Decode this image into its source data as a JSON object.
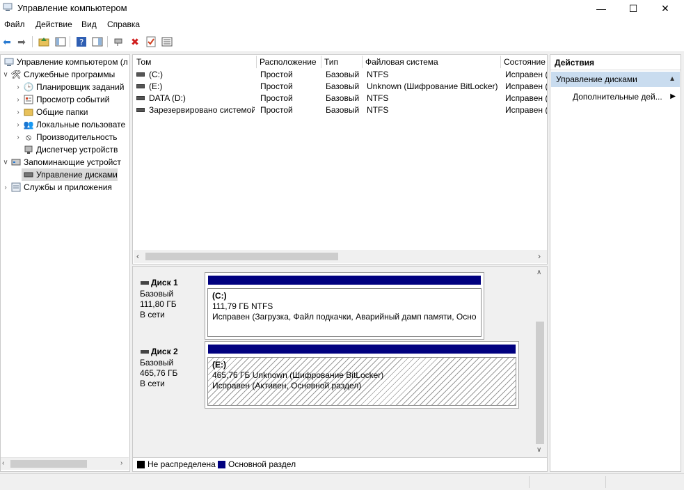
{
  "window": {
    "title": "Управление компьютером",
    "minimize": "—",
    "maximize": "☐",
    "close": "✕"
  },
  "menu": [
    "Файл",
    "Действие",
    "Вид",
    "Справка"
  ],
  "tree": {
    "root": "Управление компьютером (л",
    "utilities": "Служебные программы",
    "task_scheduler": "Планировщик заданий",
    "event_viewer": "Просмотр событий",
    "shared_folders": "Общие папки",
    "local_users": "Локальные пользовате",
    "performance": "Производительность",
    "device_manager": "Диспетчер устройств",
    "storage": "Запоминающие устройст",
    "disk_management": "Управление дисками",
    "services": "Службы и приложения"
  },
  "volumes": {
    "columns": [
      "Том",
      "Расположение",
      "Тип",
      "Файловая система",
      "Состояние"
    ],
    "rows": [
      [
        "(C:)",
        "Простой",
        "Базовый",
        "NTFS",
        "Исправен ("
      ],
      [
        "(E:)",
        "Простой",
        "Базовый",
        "Unknown (Шифрование BitLocker)",
        "Исправен ("
      ],
      [
        "DATA (D:)",
        "Простой",
        "Базовый",
        "NTFS",
        "Исправен ("
      ],
      [
        "Зарезервировано системой",
        "Простой",
        "Базовый",
        "NTFS",
        "Исправен ("
      ]
    ]
  },
  "disks": [
    {
      "name": "Диск 1",
      "type": "Базовый",
      "size": "111,80 ГБ",
      "status": "В сети",
      "part_name": "(C:)",
      "part_size": "111,79 ГБ NTFS",
      "part_status": "Исправен (Загрузка, Файл подкачки, Аварийный дамп памяти, Осно"
    },
    {
      "name": "Диск 2",
      "type": "Базовый",
      "size": "465,76 ГБ",
      "status": "В сети",
      "part_name": "(E:)",
      "part_size": "465,76 ГБ Unknown (Шифрование BitLocker)",
      "part_status": "Исправен (Активен, Основной раздел)"
    }
  ],
  "legend": {
    "unallocated": "Не распределена",
    "primary": "Основной раздел"
  },
  "actions": {
    "title": "Действия",
    "section": "Управление дисками",
    "more": "Дополнительные дей..."
  },
  "colors": {
    "primary_partition": "#00007f",
    "unallocated": "#000000",
    "selection": "#c9dcef"
  }
}
